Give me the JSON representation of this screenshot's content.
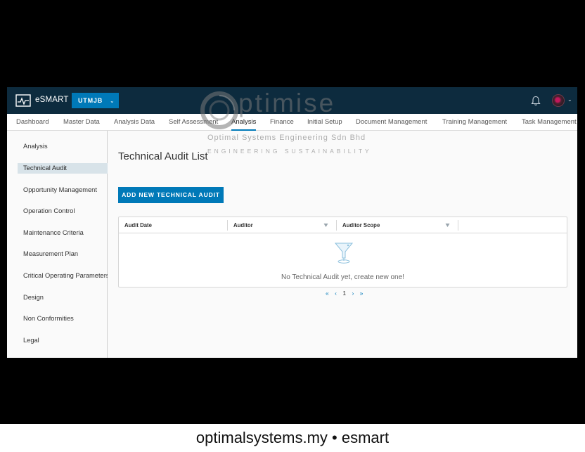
{
  "header": {
    "app_title": "eSMART",
    "org_select": "UTMJB",
    "icons": {
      "logo": "pulse-logo-icon",
      "notifications": "bell-icon",
      "avatar": "user-avatar"
    }
  },
  "nav": {
    "tabs": [
      {
        "label": "Dashboard"
      },
      {
        "label": "Master Data"
      },
      {
        "label": "Analysis Data"
      },
      {
        "label": "Self Assessment"
      },
      {
        "label": "Analysis",
        "active": true
      },
      {
        "label": "Finance"
      },
      {
        "label": "Initial Setup"
      },
      {
        "label": "Document Management"
      },
      {
        "label": "Training Management"
      },
      {
        "label": "Task Management"
      }
    ]
  },
  "sidebar": {
    "items": [
      {
        "label": "Analysis"
      },
      {
        "label": "Technical Audit",
        "active": true
      },
      {
        "label": "Opportunity Management"
      },
      {
        "label": "Operation Control"
      },
      {
        "label": "Maintenance Criteria"
      },
      {
        "label": "Measurement Plan"
      },
      {
        "label": "Critical Operating Parameters"
      },
      {
        "label": "Design"
      },
      {
        "label": "Non Conformities"
      },
      {
        "label": "Legal"
      }
    ]
  },
  "main": {
    "title": "Technical Audit List",
    "add_button": "ADD NEW TECHNICAL AUDIT",
    "grid": {
      "columns": [
        {
          "label": "Audit Date"
        },
        {
          "label": "Auditor"
        },
        {
          "label": "Auditor Scope"
        }
      ],
      "empty_message": "No Technical Audit yet, create new one!"
    },
    "pagination": {
      "first": "«",
      "prev": "‹",
      "current": "1",
      "next": "›",
      "last": "»"
    }
  },
  "watermark": {
    "word": "ptimise",
    "line1": "Optimal Systems Engineering Sdn Bhd",
    "line2": "ENGINEERING SUSTAINABILITY"
  },
  "footer": {
    "caption": "optimalsystems.my • esmart"
  },
  "colors": {
    "header_bg": "#0d2b3e",
    "accent": "#0079b8",
    "active_side": "#d8e3e9"
  }
}
